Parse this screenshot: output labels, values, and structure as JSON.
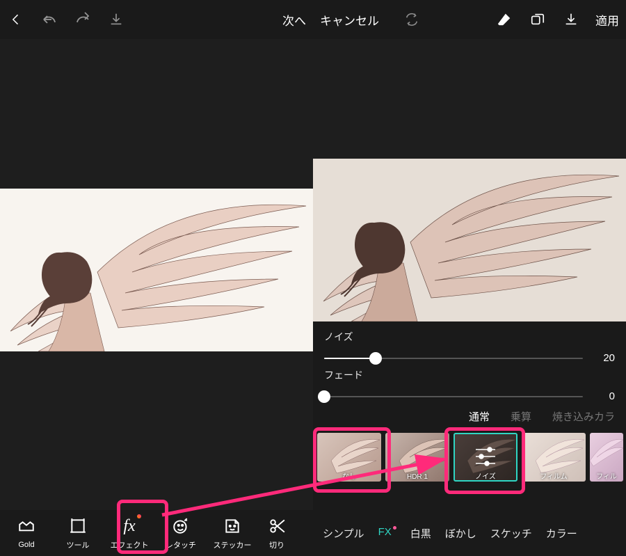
{
  "left": {
    "nextLabel": "次へ",
    "tools": [
      {
        "label": "Gold"
      },
      {
        "label": "ツール"
      },
      {
        "label": "エフェクト"
      },
      {
        "label": "レタッチ"
      },
      {
        "label": "ステッカー"
      },
      {
        "label": "切り"
      }
    ]
  },
  "right": {
    "cancelLabel": "キャンセル",
    "applyLabel": "適用",
    "sliders": {
      "noise": {
        "label": "ノイズ",
        "value": 20,
        "max": 100
      },
      "fade": {
        "label": "フェード",
        "value": 0,
        "max": 100
      }
    },
    "blendModes": {
      "items": [
        "通常",
        "乗算",
        "焼き込みカラ"
      ],
      "active": 0
    },
    "presets": [
      {
        "label": "なし"
      },
      {
        "label": "HDR 1"
      },
      {
        "label": "ノイズ",
        "selected": true
      },
      {
        "label": "フィルム"
      },
      {
        "label": "フィル"
      }
    ],
    "categories": {
      "items": [
        "シンプル",
        "FX",
        "白黒",
        "ぼかし",
        "スケッチ",
        "カラー"
      ],
      "active": 1
    }
  }
}
